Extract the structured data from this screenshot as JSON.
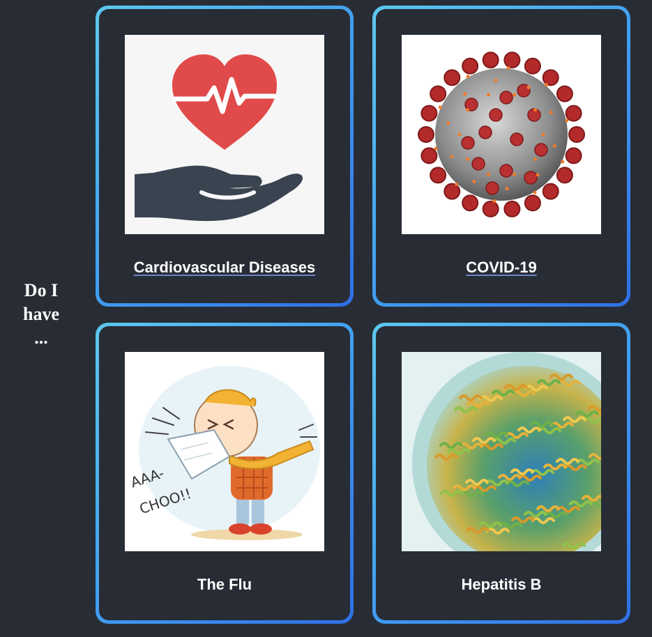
{
  "prompt": {
    "line1": "Do I",
    "line2": "have",
    "line3": "..."
  },
  "cards": [
    {
      "title": "Cardiovascular Diseases",
      "icon": "heart-hand-icon"
    },
    {
      "title": "COVID-19",
      "icon": "virus-icon"
    },
    {
      "title": "The Flu",
      "icon": "sneezing-child-icon"
    },
    {
      "title": "Hepatitis B",
      "icon": "hepatitis-virus-icon"
    }
  ],
  "illustration_text": {
    "sneeze_line1": "AAA-",
    "sneeze_line2": "CHOO!!"
  },
  "colors": {
    "background": "#282c35",
    "card_border_start": "#5cc8ee",
    "card_border_end": "#2f6fe6",
    "heart_red": "#e04a4a",
    "hand_dark": "#3a4350"
  }
}
